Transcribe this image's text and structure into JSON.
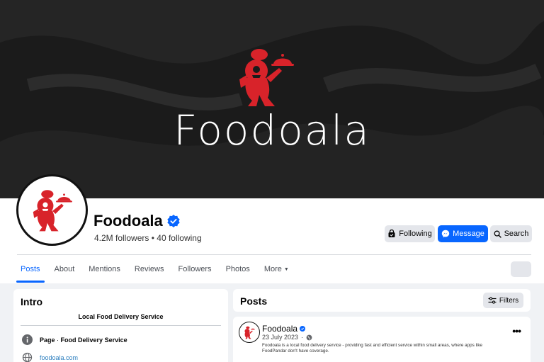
{
  "cover": {
    "brand_title": "Foodoala"
  },
  "profile": {
    "name": "Foodoala",
    "verified_icon": "verified-badge-icon",
    "followers": "4.2M followers",
    "following": "40 following",
    "separator": "•"
  },
  "actions": {
    "following_label": "Following",
    "message_label": "Message",
    "search_label": "Search"
  },
  "tabs": [
    {
      "label": "Posts",
      "active": true
    },
    {
      "label": "About"
    },
    {
      "label": "Mentions"
    },
    {
      "label": "Reviews"
    },
    {
      "label": "Followers"
    },
    {
      "label": "Photos"
    },
    {
      "label": "More"
    }
  ],
  "intro": {
    "title": "Intro",
    "bio": "Local Food Delivery Service",
    "category_prefix": "Page",
    "category_dot": "·",
    "category": "Food Delivery Service",
    "website": "foodoala.com"
  },
  "posts_section": {
    "title": "Posts",
    "filters_label": "Filters"
  },
  "post": {
    "author": "Foodoala",
    "date": "23 July 2023",
    "date_dot": "·",
    "text": "Foodoala is a local food delivery service - providing fast and efficient service within small areas, where apps like FoodPandar don't have coverage.",
    "menu": "•••"
  },
  "colors": {
    "brand_red": "#d8232a",
    "accent_blue": "#0866ff",
    "cover_bg": "#1b1b1b"
  }
}
